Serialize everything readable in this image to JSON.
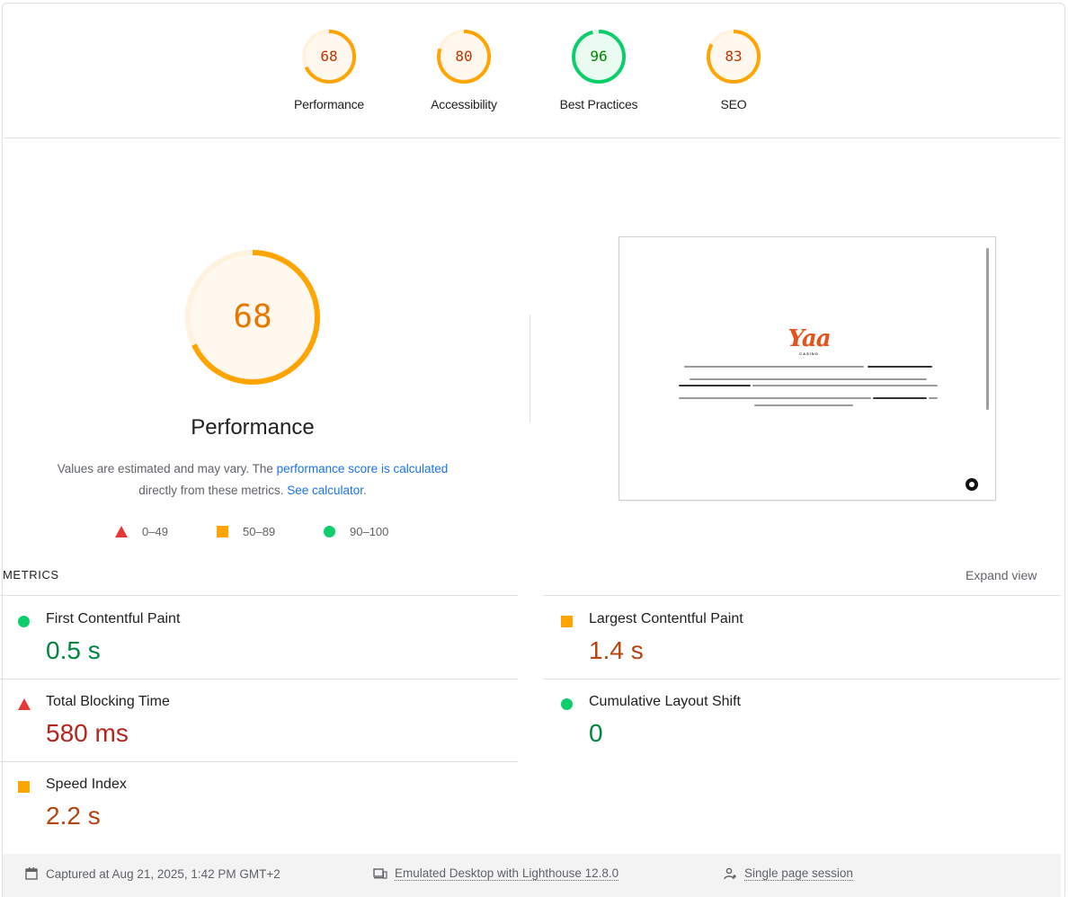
{
  "categories": [
    {
      "label": "Performance",
      "score": "68",
      "level": "average"
    },
    {
      "label": "Accessibility",
      "score": "80",
      "level": "average"
    },
    {
      "label": "Best Practices",
      "score": "96",
      "level": "pass"
    },
    {
      "label": "SEO",
      "score": "83",
      "level": "average"
    }
  ],
  "performance": {
    "score": "68",
    "score_fraction": 0.68,
    "title": "Performance",
    "desc_prefix": "Values are estimated and may vary. The ",
    "desc_link1": "performance score is calculated",
    "desc_mid": "directly from these metrics. ",
    "desc_link2": "See calculator",
    "desc_suffix": "."
  },
  "legend": {
    "fail": "0–49",
    "average": "50–89",
    "pass": "90–100"
  },
  "metrics": {
    "header": "METRICS",
    "expand": "Expand view",
    "fcp": {
      "name": "First Contentful Paint",
      "value": "0.5 s",
      "status": "pass"
    },
    "lcp": {
      "name": "Largest Contentful Paint",
      "value": "1.4 s",
      "status": "average"
    },
    "tbt": {
      "name": "Total Blocking Time",
      "value": "580 ms",
      "status": "fail"
    },
    "cls": {
      "name": "Cumulative Layout Shift",
      "value": "0",
      "status": "pass"
    },
    "si": {
      "name": "Speed Index",
      "value": "2.2 s",
      "status": "average"
    }
  },
  "thumbnail": {
    "logo": "Yaa",
    "logo_sub": "CASINO"
  },
  "footer": {
    "captured": "Captured at Aug 21, 2025, 1:42 PM GMT+2",
    "emulated": "Emulated Desktop with Lighthouse 12.8.0",
    "session": "Single page session"
  },
  "colors": {
    "pass": "#0cce6b",
    "average": "#ffa400",
    "fail": "#ff4e42"
  }
}
